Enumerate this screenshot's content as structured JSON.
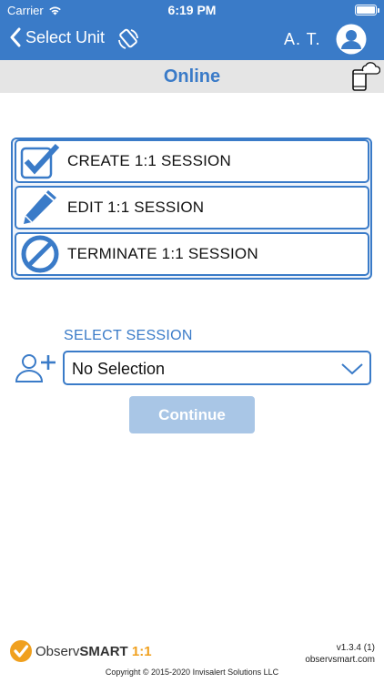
{
  "status_bar": {
    "carrier": "Carrier",
    "time": "6:19 PM"
  },
  "nav": {
    "back_label": "Select Unit",
    "user_initials": "A. T."
  },
  "subheader": {
    "title": "Online"
  },
  "actions": [
    {
      "label": "CREATE 1:1 SESSION",
      "icon": "checkbox-check-icon"
    },
    {
      "label": "EDIT 1:1 SESSION",
      "icon": "pencil-icon"
    },
    {
      "label": "TERMINATE 1:1 SESSION",
      "icon": "prohibited-icon"
    }
  ],
  "session": {
    "label": "SELECT SESSION",
    "selected": "No Selection"
  },
  "continue_label": "Continue",
  "footer": {
    "logo_prefix": "Observ",
    "logo_bold": "SMART",
    "logo_suffix": "1:1",
    "version": "v1.3.4 (1)",
    "website": "observsmart.com",
    "copyright": "Copyright © 2015-2020 Invisalert Solutions LLC"
  },
  "colors": {
    "brand_blue": "#3a7bc8",
    "disabled_button": "#a9c6e6",
    "logo_orange": "#f0a01e"
  }
}
